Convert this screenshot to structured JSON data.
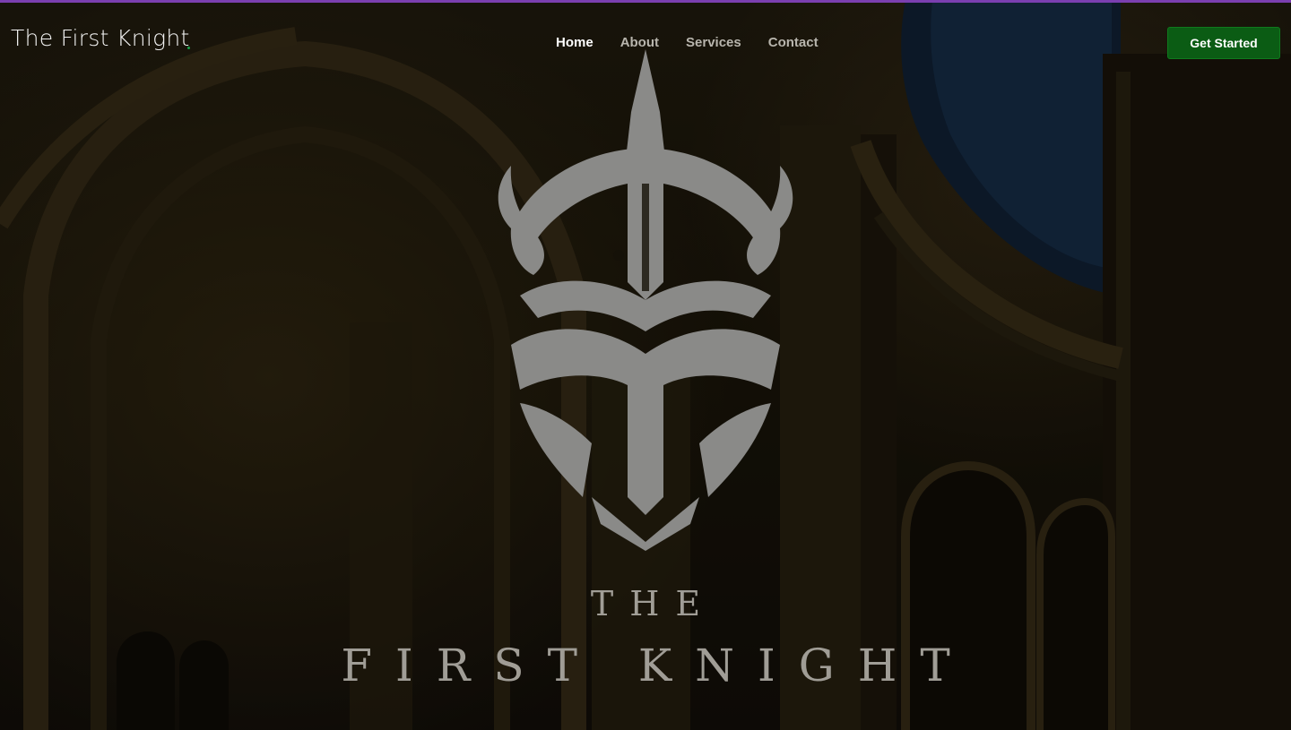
{
  "brand": {
    "name": "The First Knight"
  },
  "nav": {
    "items": [
      {
        "label": "Home",
        "active": true
      },
      {
        "label": "About",
        "active": false
      },
      {
        "label": "Services",
        "active": false
      },
      {
        "label": "Contact",
        "active": false
      }
    ]
  },
  "cta": {
    "label": "Get Started"
  },
  "hero": {
    "emblem_icon": "knight-helmet-icon",
    "wordmark_top": "THE",
    "wordmark_bottom": "FIRST KNIGHT"
  },
  "colors": {
    "accent_bar": "#7b3fb0",
    "cta_bg": "#0b5c14",
    "brand_dot": "#19a34a",
    "emblem": "#8a8a88"
  }
}
